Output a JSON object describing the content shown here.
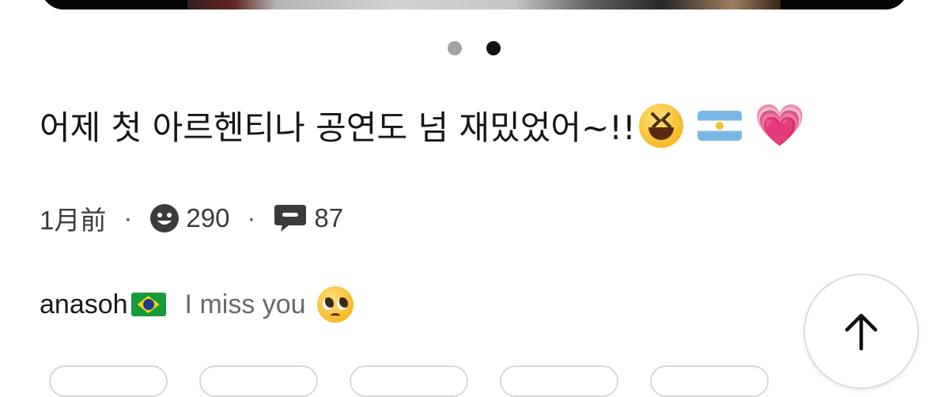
{
  "post": {
    "caption_text": "어제 첫 아르헨티나 공연도 넘 재밌었어~!!",
    "caption_emojis": [
      "grinning-squinting-face-emoji",
      "argentina-flag-emoji",
      "growing-heart-emoji"
    ],
    "time": "1月前",
    "separator": "·",
    "reactions_count": "290",
    "comments_count": "87",
    "carousel": {
      "page_count": 2,
      "active_index": 1
    }
  },
  "comment": {
    "username": "anasoh",
    "user_flag": "brazil-flag-emoji",
    "text": "I miss you",
    "emoji": "pleading-face-emoji"
  },
  "colors": {
    "text_primary": "#161616",
    "text_secondary": "#6a6a6a",
    "dot_active": "#111111",
    "dot_inactive": "#a3a3a3",
    "heart": "#ec3e9a"
  },
  "icons": {
    "reactions": "smiley-face-icon",
    "comments": "speech-bubble-icon",
    "scroll_top": "arrow-up-icon"
  }
}
